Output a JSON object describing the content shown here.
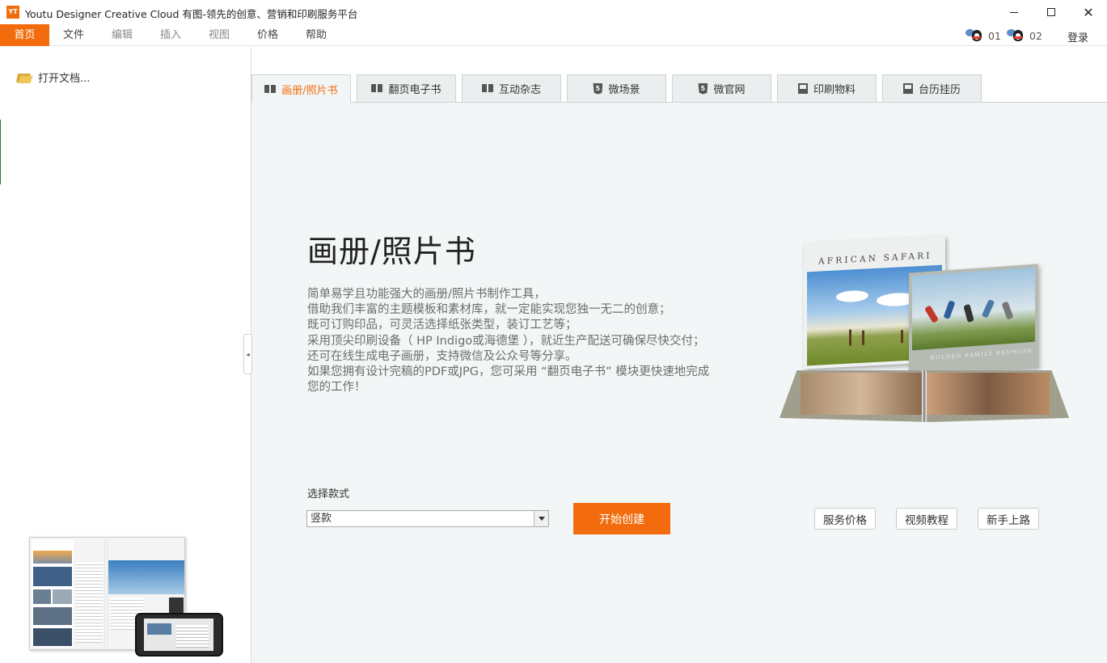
{
  "window": {
    "icon_text": "YT",
    "title": "Youtu Designer Creative Cloud 有图-领先的创意、营销和印刷服务平台",
    "close_glyph": "✕"
  },
  "menu": {
    "items": [
      "首页",
      "文件",
      "编辑",
      "插入",
      "视图",
      "价格",
      "帮助"
    ],
    "qq1": "01",
    "qq2": "02",
    "login": "登录"
  },
  "sidebar": {
    "open_doc": "打开文档..."
  },
  "collapse_glyph": "◂",
  "tabs": [
    {
      "label": "画册/照片书",
      "icon": "book-icon"
    },
    {
      "label": "翻页电子书",
      "icon": "book-icon"
    },
    {
      "label": "互动杂志",
      "icon": "book-icon"
    },
    {
      "label": "微场景",
      "icon": "html5-icon"
    },
    {
      "label": "微官网",
      "icon": "html5-icon"
    },
    {
      "label": "印刷物料",
      "icon": "print-icon"
    },
    {
      "label": "台历挂历",
      "icon": "print-icon"
    }
  ],
  "html5_glyph": "5",
  "main": {
    "title": "画册/照片书",
    "description": [
      "简单易学且功能强大的画册/照片书制作工具，",
      "借助我们丰富的主题模板和素材库，就一定能实现您独一无二的创意；",
      "既可订购印品，可灵活选择纸张类型，装订工艺等；",
      "采用顶尖印刷设备（ HP Indigo或海德堡 ），就近生产配送可确保尽快交付；",
      "还可在线生成电子画册，支持微信及公众号等分享。",
      "如果您拥有设计完稿的PDF或JPG，您可采用 “翻页电子书” 模块更快速地完成您的工作！"
    ],
    "style_label": "选择款式",
    "style_value": "竖款",
    "start_button": "开始创建",
    "links": [
      "服务价格",
      "视频教程",
      "新手上路"
    ]
  },
  "hero": {
    "book1_title": "AFRICAN SAFARI",
    "book2_title": "HOLDEN FAMILY REUNION"
  },
  "colors": {
    "accent": "#f26c0d",
    "content_bg": "#f3f6f6"
  }
}
